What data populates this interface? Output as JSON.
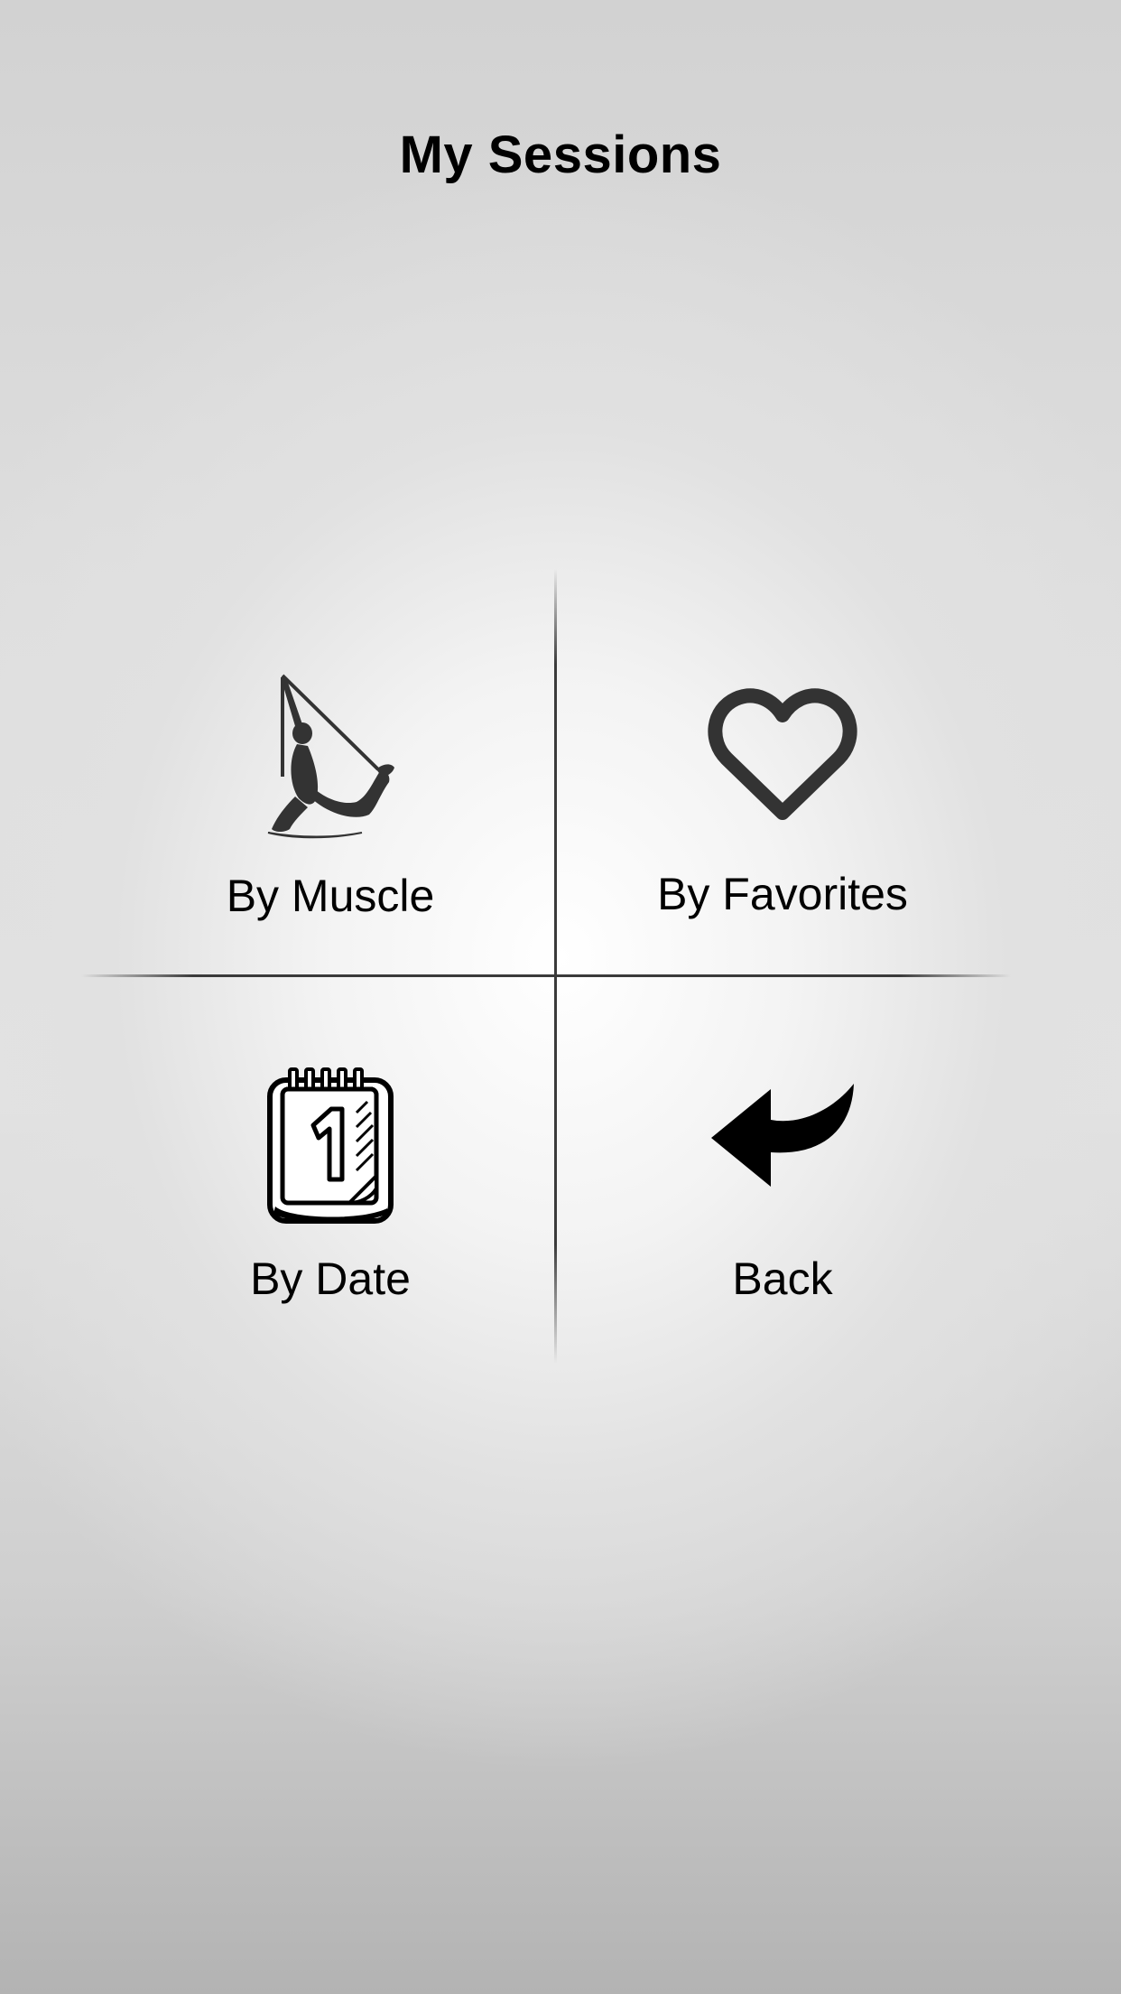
{
  "header": {
    "title": "My Sessions"
  },
  "menu": {
    "items": [
      {
        "label": "By Muscle",
        "icon": "aerial-yoga-figure-icon"
      },
      {
        "label": "By Favorites",
        "icon": "heart-icon"
      },
      {
        "label": "By Date",
        "icon": "calendar-icon"
      },
      {
        "label": "Back",
        "icon": "back-arrow-icon"
      }
    ]
  },
  "colors": {
    "text": "#000000",
    "icon_dark": "#333333",
    "divider": "#3a3a3a",
    "background_center": "#ffffff",
    "background_edge": "#b3b3b3"
  }
}
